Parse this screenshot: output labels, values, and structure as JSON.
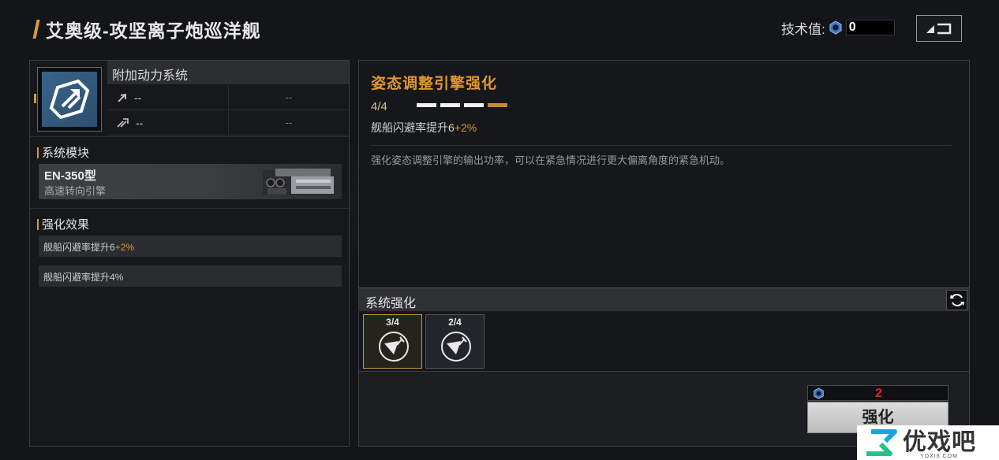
{
  "header": {
    "title": "艾奥级-攻坚离子炮巡洋舰",
    "tech_label": "技术值:",
    "tech_value": "0",
    "back_icon": "back-arrow-icon"
  },
  "left": {
    "power_system_title": "附加动力系统",
    "power_rows": [
      {
        "left": "--",
        "right": "--"
      },
      {
        "left": "--",
        "right": "--"
      }
    ],
    "system_module_title": "系统模块",
    "module": {
      "name": "EN-350型",
      "desc": "高速转向引擎"
    },
    "effects_title": "强化效果",
    "effects": [
      {
        "text": "舰船闪避率提升6",
        "bonus": "+2%"
      },
      {
        "text": "舰船闪避率提升4%",
        "bonus": ""
      }
    ]
  },
  "right": {
    "enhance_title": "姿态调整引擎强化",
    "level": "4/4",
    "level_filled": 4,
    "level_total": 4,
    "stat_text": "舰船闪避率提升6",
    "stat_bonus": "+2%",
    "description": "强化姿态调整引擎的输出功率，可以在紧急情况进行更大偏离角度的紧急机动。",
    "system_enhance_title": "系统强化",
    "slots": [
      {
        "count": "3/4",
        "selected": true
      },
      {
        "count": "2/4",
        "selected": false
      }
    ],
    "cost_value": "2",
    "enhance_button": "强化"
  },
  "watermark": {
    "text": "优戏吧",
    "sub": "YOXI8.COM"
  },
  "colors": {
    "accent": "#e0972f",
    "cost_red": "#e02424",
    "icon_blue": "#3a6489"
  }
}
